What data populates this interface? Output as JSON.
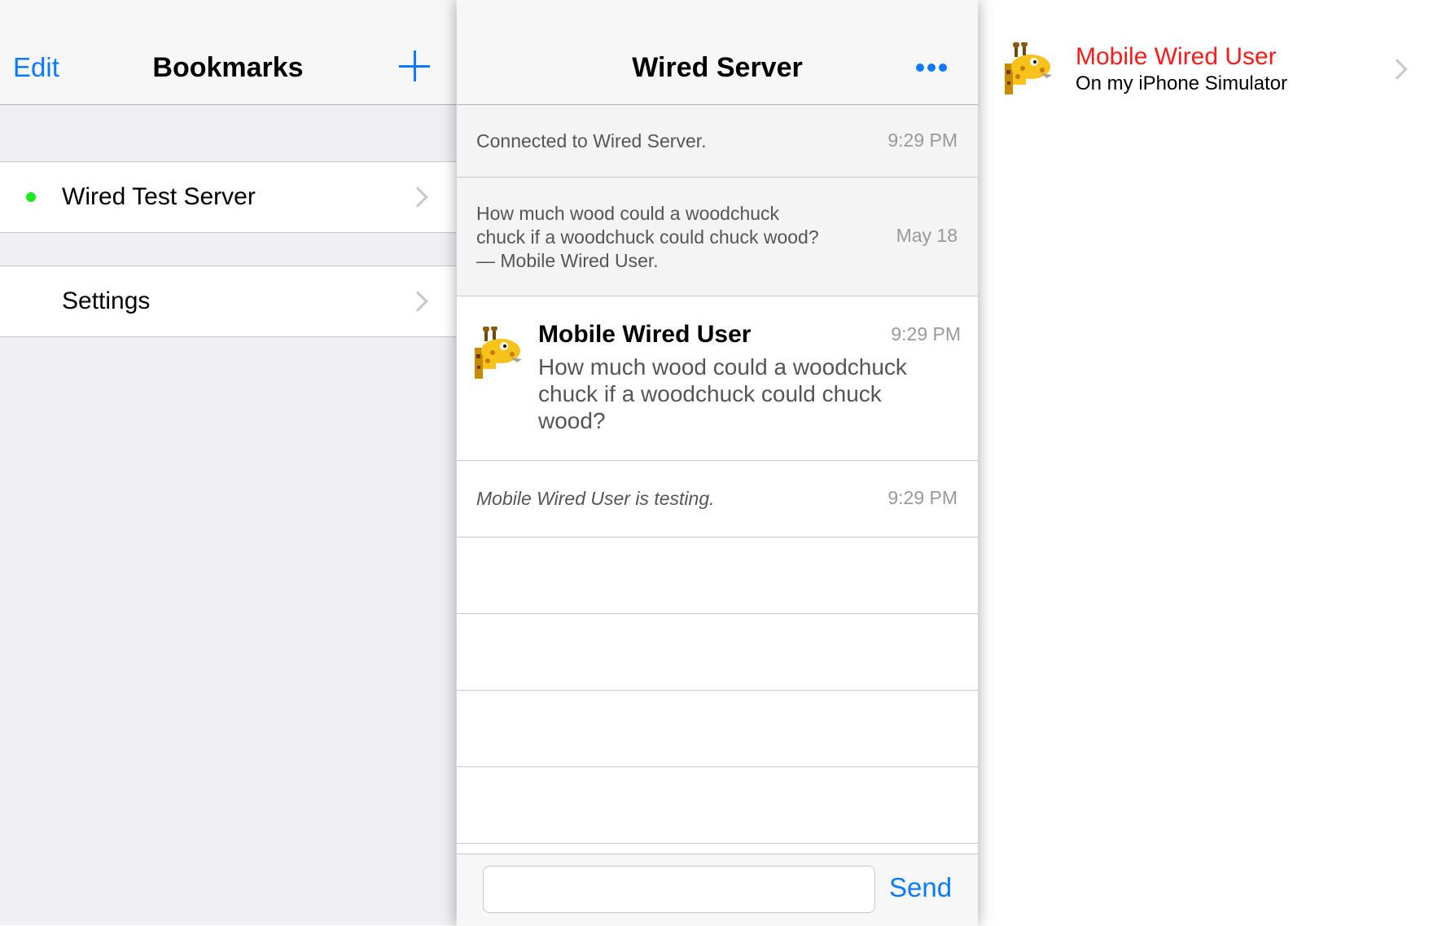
{
  "colors": {
    "tint": "#0a7aff",
    "status_online": "#1ee81e",
    "user_highlight": "#ff1a1a",
    "separator": "#c8c7cc"
  },
  "bookmarks": {
    "edit_label": "Edit",
    "title": "Bookmarks",
    "add_icon": "plus-icon",
    "servers": [
      {
        "label": "Wired Test Server",
        "status": "online"
      }
    ],
    "settings_label": "Settings"
  },
  "chat": {
    "title": "Wired Server",
    "more_icon": "ellipsis-icon",
    "messages": [
      {
        "type": "event",
        "text": "Connected to Wired Server.",
        "time": "9:29 PM"
      },
      {
        "type": "topic",
        "text": "How much wood could a woodchuck chuck if a woodchuck could chuck wood? — Mobile Wired User.",
        "time": "May 18"
      },
      {
        "type": "message",
        "sender": "Mobile Wired User",
        "text": "How much wood could a woodchuck chuck if a woodchuck could chuck wood?",
        "time": "9:29 PM",
        "avatar": "giraffe-icon"
      },
      {
        "type": "action",
        "text": "Mobile Wired User is testing.",
        "time": "9:29 PM"
      }
    ],
    "input_value": "",
    "input_placeholder": "",
    "send_label": "Send"
  },
  "users": [
    {
      "name": "Mobile Wired User",
      "status": "On my iPhone Simulator",
      "avatar": "giraffe-icon"
    }
  ]
}
